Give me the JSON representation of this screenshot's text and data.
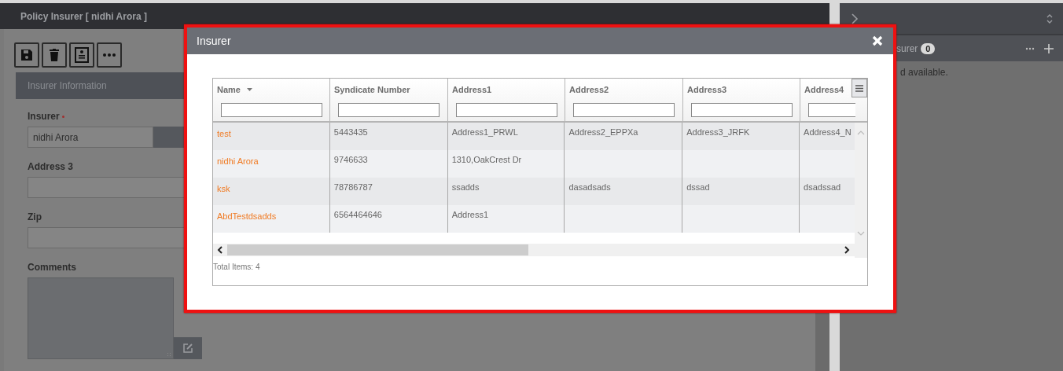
{
  "page": {
    "title": "Policy Insurer [ nidhi Arora ]",
    "section": "Insurer Information",
    "fields": [
      {
        "kind": "lookup",
        "label": "Insurer",
        "required": true,
        "value": "nidhi Arora"
      },
      {
        "kind": "text",
        "label": "Address 3",
        "required": false
      },
      {
        "kind": "text",
        "label": "Zip",
        "required": false
      },
      {
        "kind": "textarea",
        "label": "Comments",
        "required": false
      }
    ]
  },
  "side_panel": {
    "section_label": "surer",
    "count": "0",
    "message": "d available."
  },
  "dialog": {
    "title": "Insurer",
    "table": {
      "columns": [
        {
          "label": "Name",
          "sorted": true
        },
        {
          "label": "Syndicate Number",
          "sorted": false
        },
        {
          "label": "Address1",
          "sorted": false
        },
        {
          "label": "Address2",
          "sorted": false
        },
        {
          "label": "Address3",
          "sorted": false
        },
        {
          "label": "Address4",
          "sorted": false
        }
      ],
      "rows": [
        [
          "test",
          "5443435",
          "Address1_PRWL",
          "Address2_EPPXa",
          "Address3_JRFK",
          "Address4_N"
        ],
        [
          "nidhi Arora",
          "9746633",
          "1310,OakCrest Dr",
          "",
          "",
          ""
        ],
        [
          "ksk",
          "78786787",
          "ssadds",
          "dasadsads",
          "dssad",
          "dsadssad"
        ],
        [
          "AbdTestdsadds",
          "6564464646",
          "Address1",
          "",
          "",
          ""
        ]
      ],
      "footer": "Total Items: 4"
    }
  }
}
